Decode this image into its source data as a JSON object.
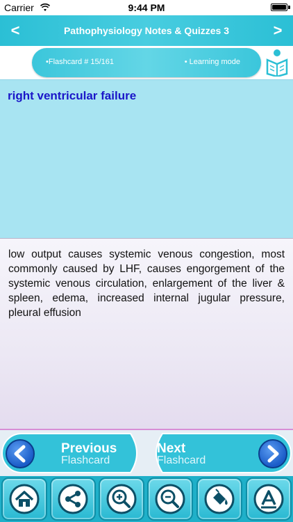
{
  "status_bar": {
    "carrier": "Carrier",
    "time": "9:44 PM",
    "battery_level": 1.0
  },
  "nav": {
    "title": "Pathophysiology Notes & Quizzes 3",
    "back_glyph": "<",
    "forward_glyph": ">"
  },
  "info": {
    "flashcard_label": "•Flashcard #  15/161",
    "mode_label": "• Learning mode"
  },
  "card": {
    "term": "right ventricular failure",
    "definition": "low output causes systemic venous congestion, most commonly caused by LHF, causes engorgement of the systemic venous circulation, enlargement of the liver & spleen, edema, increased internal jugular pressure, pleural effusion"
  },
  "buttons": {
    "previous_title": "Previous",
    "previous_sub": "Flashcard",
    "next_title": "Next",
    "next_sub": "Flashcard"
  },
  "toolbar": {
    "icons": [
      "home-icon",
      "share-icon",
      "zoom-in-icon",
      "zoom-out-icon",
      "paint-bucket-icon",
      "font-icon"
    ]
  },
  "colors": {
    "accent": "#2bbfd5",
    "term_color": "#1a16c8",
    "card_front_bg": "#a8e4f2",
    "circle_button": "#1a5cc8"
  }
}
